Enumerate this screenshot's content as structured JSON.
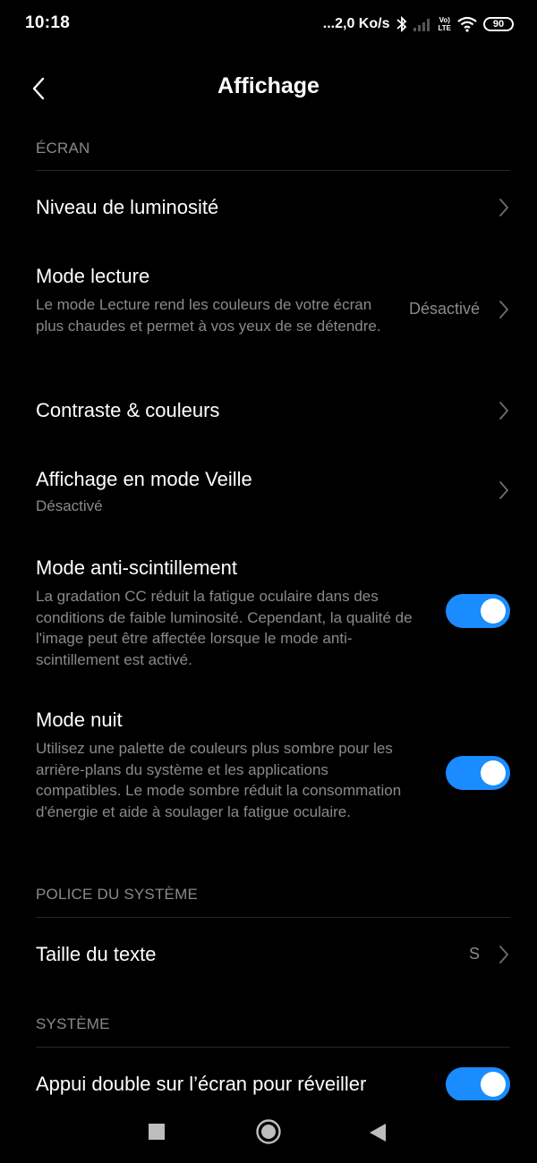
{
  "status_bar": {
    "time": "10:18",
    "net_speed": "...2,0 Ko/s",
    "lte_top": "Vo)",
    "lte_bottom": "LTE",
    "battery": "90"
  },
  "header": {
    "title": "Affichage"
  },
  "sections": {
    "ecran": {
      "label": "ÉCRAN",
      "items": [
        {
          "title": "Niveau de luminosité"
        },
        {
          "title": "Mode lecture",
          "desc": "Le mode Lecture rend les couleurs de votre écran plus chaudes et permet à vos yeux de se détendre.",
          "value": "Désactivé"
        },
        {
          "title": "Contraste & couleurs"
        },
        {
          "title": "Affichage en mode Veille",
          "desc": "Désactivé"
        },
        {
          "title": "Mode anti-scintillement",
          "desc": "La gradation CC réduit la fatigue oculaire dans des conditions de faible luminosité. Cependant, la qualité de l'image peut être affectée lorsque le mode anti-scintillement est activé.",
          "toggle": true
        },
        {
          "title": "Mode nuit",
          "desc": "Utilisez une palette de couleurs plus sombre pour les arrière-plans du système et les applications compatibles. Le mode sombre réduit la consommation d'énergie et aide à soulager la fatigue oculaire.",
          "toggle": true
        }
      ]
    },
    "police": {
      "label": "POLICE DU SYSTÈME",
      "items": [
        {
          "title": "Taille du texte",
          "value": "S"
        }
      ]
    },
    "systeme": {
      "label": "SYSTÈME",
      "items": [
        {
          "title": "Appui double sur l’écran pour réveiller",
          "toggle": true
        }
      ]
    }
  },
  "colors": {
    "background": "#000000",
    "accent": "#1a8cff",
    "secondary_text": "#8a8a8a"
  },
  "icons": [
    "back-icon",
    "chevron-right-icon",
    "bluetooth-icon",
    "signal-icon",
    "wifi-icon",
    "battery-icon",
    "recents-icon",
    "home-icon",
    "back-nav-icon"
  ]
}
